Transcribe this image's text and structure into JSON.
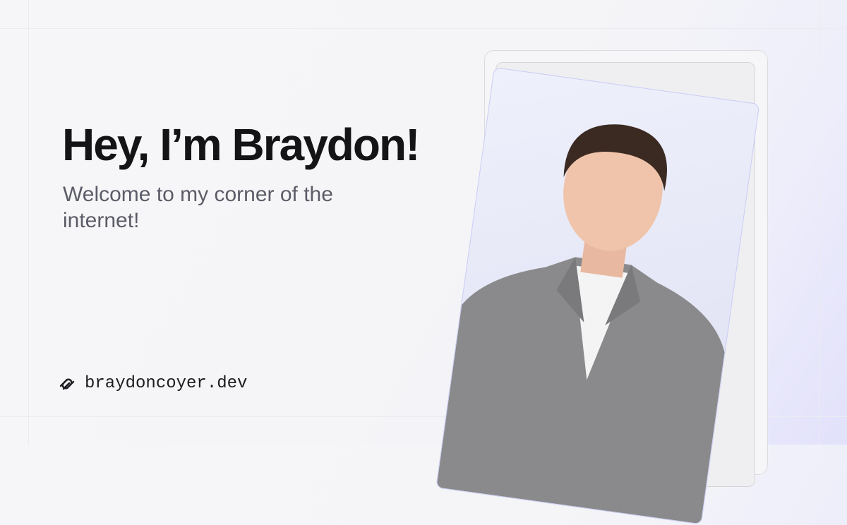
{
  "hero": {
    "title": "Hey, I’m Braydon!",
    "subtitle": "Welcome to my corner of the internet!"
  },
  "brand": {
    "icon": "link-chain-icon",
    "url": "braydoncoyer.dev"
  },
  "photo": {
    "alt": "portrait-photo"
  },
  "colors": {
    "title": "#141416",
    "subtitle": "#5c5c68",
    "accent_gradient": "#e2e1fb"
  }
}
